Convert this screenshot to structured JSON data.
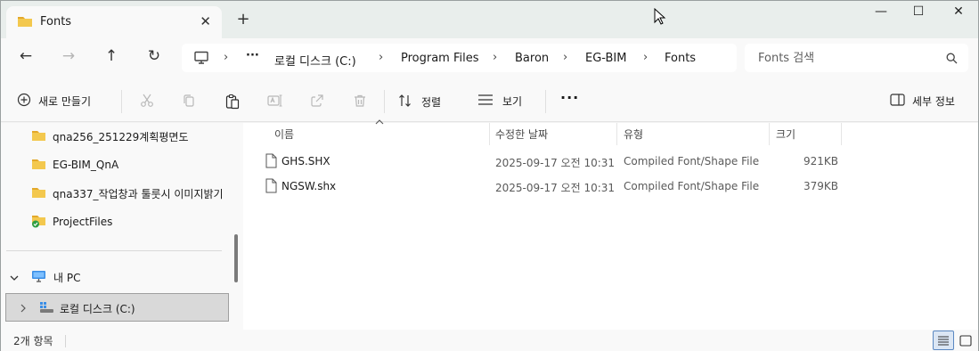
{
  "tab": {
    "title": "Fonts",
    "close_glyph": "✕",
    "new_tab_glyph": "+"
  },
  "window_controls": {
    "minimize": "—",
    "maximize": "☐",
    "close": "✕"
  },
  "nav": {
    "back": "←",
    "forward": "→",
    "up": "↑",
    "refresh": "↻"
  },
  "breadcrumb": {
    "overflow": "···",
    "separator": "›",
    "items": [
      "로컬 디스크 (C:)",
      "Program Files",
      "Baron",
      "EG-BIM",
      "Fonts"
    ]
  },
  "search": {
    "placeholder": "Fonts 검색"
  },
  "commandbar": {
    "new_label": "새로 만들기",
    "sort_label": "정렬",
    "view_label": "보기",
    "more_glyph": "···",
    "details_label": "세부 정보"
  },
  "navpane": {
    "folders": [
      "qna256_251229계획평면도",
      "EG-BIM_QnA",
      "qna337_작업창과 툴룻시 이미지밝기",
      "ProjectFiles"
    ],
    "pc_label": "내 PC",
    "drive_label": "로컬 디스크 (C:)"
  },
  "filelist": {
    "columns": [
      "이름",
      "수정한 날짜",
      "유형",
      "크기"
    ],
    "files": [
      {
        "name": "GHS.SHX",
        "modified": "2025-09-17 오전 10:31",
        "type": "Compiled Font/Shape File",
        "size": "921KB"
      },
      {
        "name": "NGSW.shx",
        "modified": "2025-09-17 오전 10:31",
        "type": "Compiled Font/Shape File",
        "size": "379KB"
      }
    ]
  },
  "status": {
    "item_count": "2개 항목"
  },
  "colors": {
    "folder": "#f3c84e",
    "accent": "#1f5fbf",
    "selection": "#d9d9d9"
  }
}
